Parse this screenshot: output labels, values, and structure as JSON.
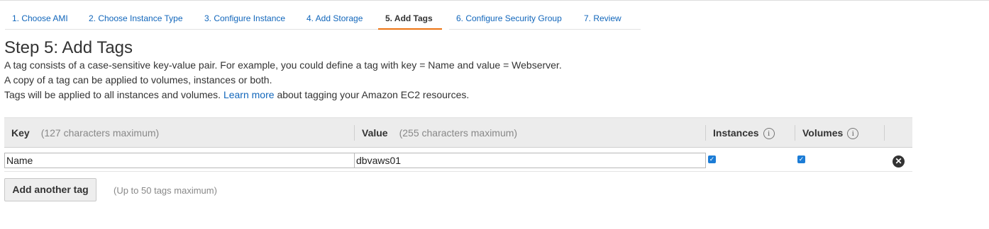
{
  "wizard": {
    "tabs": [
      {
        "label": "1. Choose AMI"
      },
      {
        "label": "2. Choose Instance Type"
      },
      {
        "label": "3. Configure Instance"
      },
      {
        "label": "4. Add Storage"
      },
      {
        "label": "5. Add Tags",
        "active": true
      },
      {
        "label": "6. Configure Security Group"
      },
      {
        "label": "7. Review"
      }
    ]
  },
  "page": {
    "title": "Step 5: Add Tags",
    "line1": "A tag consists of a case-sensitive key-value pair. For example, you could define a tag with key = Name and value = Webserver.",
    "line2": "A copy of a tag can be applied to volumes, instances or both.",
    "line3_before": "Tags will be applied to all instances and volumes.",
    "line3_link": "Learn more",
    "line3_after": "about tagging your Amazon EC2 resources."
  },
  "table": {
    "key_header": "Key",
    "key_hint": "(127 characters maximum)",
    "value_header": "Value",
    "value_hint": "(255 characters maximum)",
    "instances_header": "Instances",
    "volumes_header": "Volumes",
    "info_glyph": "i",
    "rows": [
      {
        "key": "Name",
        "value": "dbvaws01",
        "instances": true,
        "volumes": true
      }
    ]
  },
  "actions": {
    "add_label": "Add another tag",
    "add_hint": "(Up to 50 tags maximum)"
  },
  "colors": {
    "link": "#1166bb",
    "active_tab_underline": "#ec7211",
    "checkbox": "#1c7cd6"
  }
}
